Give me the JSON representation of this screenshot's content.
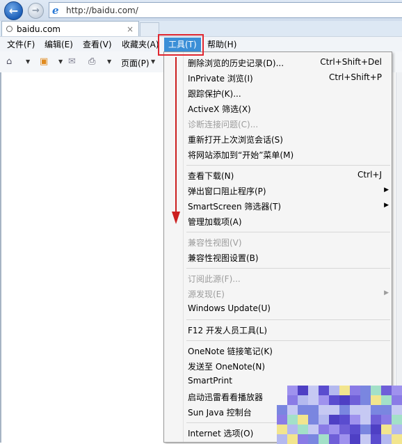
{
  "browser": {
    "url": "http://baidu.com/",
    "tab_title": "baidu.com",
    "tab_close": "×"
  },
  "menubar": {
    "items": [
      {
        "label": "文件(F)"
      },
      {
        "label": "编辑(E)"
      },
      {
        "label": "查看(V)"
      },
      {
        "label": "收藏夹(A)"
      },
      {
        "label": "工具(T)"
      },
      {
        "label": "帮助(H)"
      }
    ]
  },
  "commandbar": {
    "page_label": "页面(P)"
  },
  "tools_menu": {
    "items": [
      {
        "label": "删除浏览的历史记录(D)...",
        "shortcut": "Ctrl+Shift+Del"
      },
      {
        "label": "InPrivate 浏览(I)",
        "shortcut": "Ctrl+Shift+P"
      },
      {
        "label": "跟踪保护(K)..."
      },
      {
        "label": "ActiveX 筛选(X)"
      },
      {
        "label": "诊断连接问题(C)...",
        "disabled": true
      },
      {
        "label": "重新打开上次浏览会话(S)"
      },
      {
        "label": "将网站添加到“开始”菜单(M)"
      },
      {
        "label": "查看下载(N)",
        "shortcut": "Ctrl+J"
      },
      {
        "label": "弹出窗口阻止程序(P)",
        "submenu": "▶"
      },
      {
        "label": "SmartScreen 筛选器(T)",
        "submenu": "▶"
      },
      {
        "label": "管理加载项(A)"
      },
      {
        "label": "兼容性视图(V)",
        "disabled": true
      },
      {
        "label": "兼容性视图设置(B)"
      },
      {
        "label": "订阅此源(F)...",
        "disabled": true
      },
      {
        "label": "源发现(E)",
        "disabled": true,
        "submenu": "▶"
      },
      {
        "label": "Windows Update(U)"
      },
      {
        "label": "F12 开发人员工具(L)"
      },
      {
        "label": "OneNote 链接笔记(K)"
      },
      {
        "label": "发送至 OneNote(N)"
      },
      {
        "label": "SmartPrint"
      },
      {
        "label": "启动迅雷看看播放器"
      },
      {
        "label": "Sun Java 控制台"
      },
      {
        "label": "Internet 选项(O)"
      }
    ]
  },
  "colors": {
    "menu_highlight": "#3b8fd7",
    "annotation_red": "#e0262f",
    "arrow_red": "#cc1f1f"
  },
  "icons": {
    "back": "back-arrow-icon",
    "forward": "forward-arrow-icon",
    "browser": "ie-icon",
    "home": "home-icon",
    "rss": "rss-feed-icon",
    "mail": "mail-icon",
    "print": "printer-icon"
  }
}
